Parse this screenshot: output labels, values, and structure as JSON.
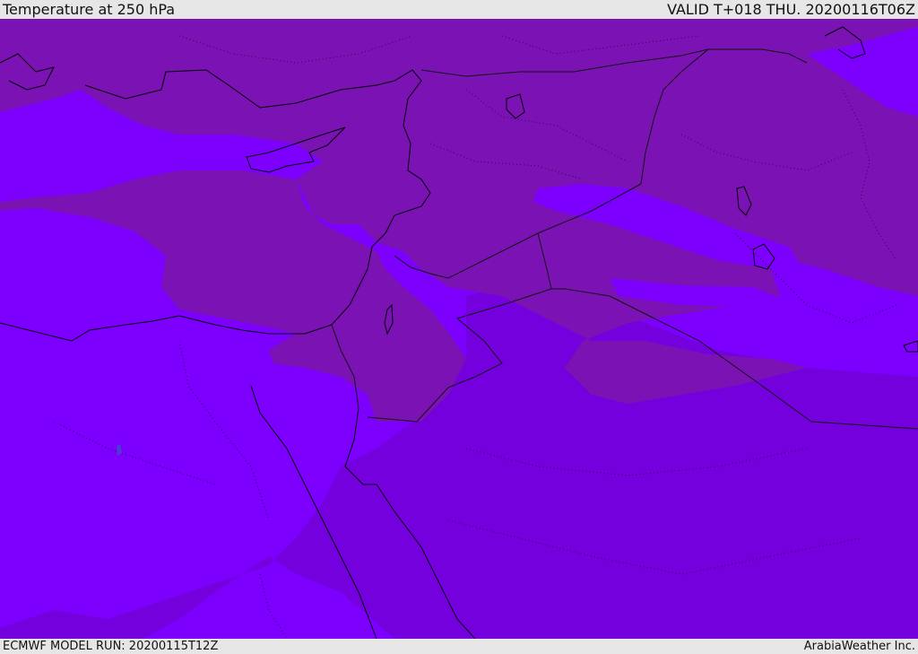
{
  "header": {
    "title": "Temperature at 250 hPa",
    "valid": "VALID T+018 THU. 20200116T06Z"
  },
  "footer": {
    "model_run": "ECMWF MODEL RUN: 20200115T12Z",
    "credit": "ArabiaWeather Inc."
  },
  "map": {
    "colors": {
      "temp_cold_magenta": "#7b12b4",
      "temp_violet": "#7d00ff",
      "temp_purple": "#7500de",
      "coastline": "#000000",
      "border": "#111111",
      "admin_border": "#2a0a4a",
      "lake": "#4a3dd6"
    }
  }
}
